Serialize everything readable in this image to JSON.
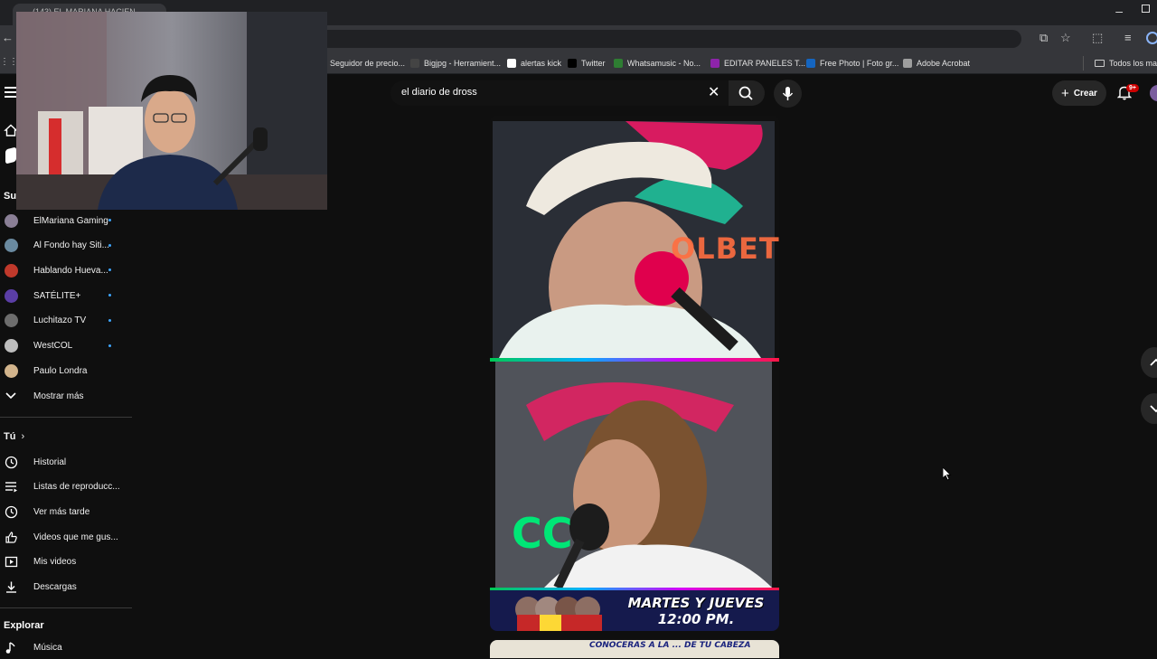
{
  "browser": {
    "tab_title": "(143) EL MARIANA HACIEN...",
    "bookmarks": [
      {
        "label": "Seguidor de precio...",
        "icon": "price-icon",
        "color": "#3b82c4"
      },
      {
        "label": "Bigjpg - Herramient...",
        "icon": "bigjpg-icon",
        "color": "#444444"
      },
      {
        "label": "alertas kick",
        "icon": "kick-icon",
        "color": "#ffffff"
      },
      {
        "label": "Twitter",
        "icon": "x-icon",
        "color": "#000000"
      },
      {
        "label": "Whatsamusic - No...",
        "icon": "whatsamusic-icon",
        "color": "#2e7d32"
      },
      {
        "label": "EDITAR PANELES T...",
        "icon": "p-icon",
        "color": "#8e24aa"
      },
      {
        "label": "Free Photo | Foto gr...",
        "icon": "freepik-icon",
        "color": "#1565c0"
      },
      {
        "label": "Adobe Acrobat",
        "icon": "acrobat-icon",
        "color": "#9e9e9e"
      }
    ],
    "all_bookmarks": "Todos los marc"
  },
  "header": {
    "search_value": "el diario de dross",
    "create_label": "Crear",
    "notifications_badge": "9+"
  },
  "sidebar": {
    "subscriptions_heading": "Sus",
    "channels": [
      {
        "label": "ElMariana Gaming",
        "color": "#8a7f96"
      },
      {
        "label": "Al Fondo hay Siti...",
        "color": "#6a8aa0"
      },
      {
        "label": "Hablando Hueva...",
        "color": "#c0392b"
      },
      {
        "label": "SATÉLITE+",
        "color": "#5b3ea6"
      },
      {
        "label": "Luchitazo TV",
        "color": "#6d6d6d"
      },
      {
        "label": "WestCOL",
        "color": "#bdbdbd"
      },
      {
        "label": "Paulo Londra",
        "color": "#d2b48c"
      }
    ],
    "show_more": "Mostrar más",
    "you_heading": "Tú",
    "you_items": [
      {
        "label": "Historial",
        "icon": "history-icon"
      },
      {
        "label": "Listas de reproducc...",
        "icon": "playlist-icon"
      },
      {
        "label": "Ver más tarde",
        "icon": "clock-icon"
      },
      {
        "label": "Videos que me gus...",
        "icon": "thumbs-up-icon"
      },
      {
        "label": "Mis videos",
        "icon": "my-videos-icon"
      },
      {
        "label": "Descargas",
        "icon": "download-icon"
      }
    ],
    "explore_heading": "Explorar",
    "explore_items": [
      {
        "label": "Música",
        "icon": "music-icon"
      }
    ]
  },
  "short": {
    "top_logo_text": "OLBET",
    "bottom_logo_text": "CC",
    "schedule_line1": "MARTES Y JUEVES",
    "schedule_line2": "12:00 PM.",
    "next_short_caption": "CONOCERAS A LA ... DE TU CABEZA"
  },
  "colors": {
    "background": "#0f0f0f",
    "accent_red": "#cc0000",
    "link_blue": "#3ea6ff"
  }
}
